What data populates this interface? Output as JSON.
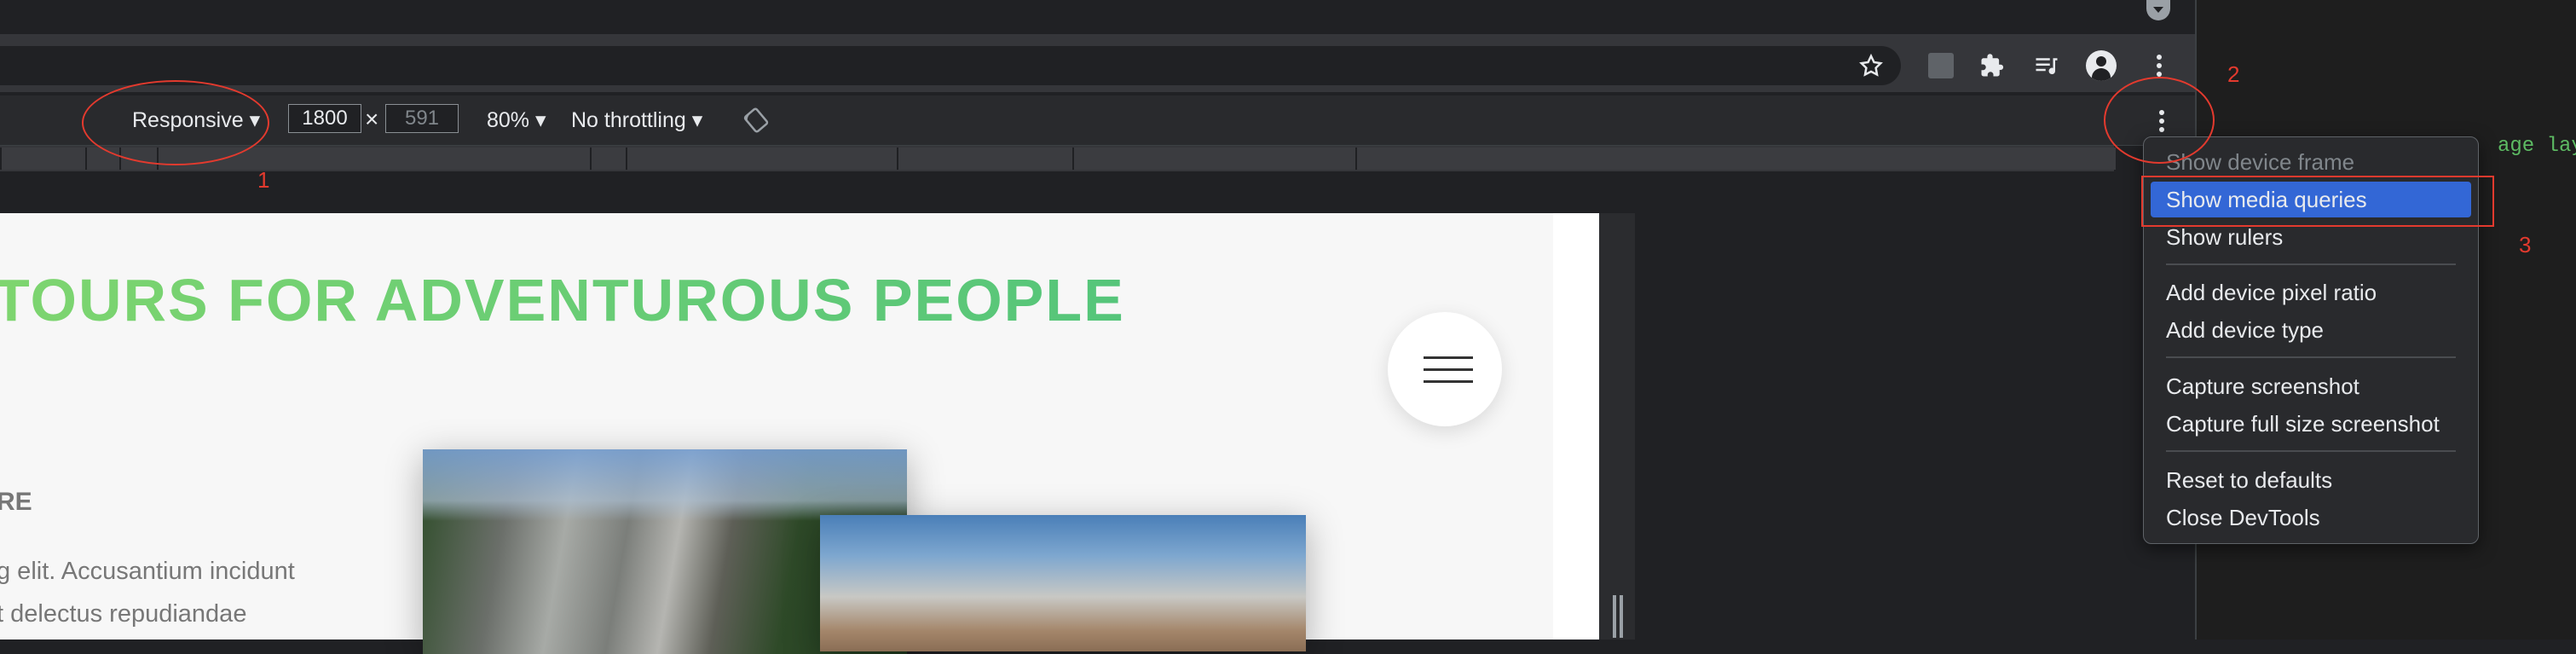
{
  "browser": {
    "tab_icon": "chevron-down-icon",
    "toolbar_icons": [
      "star-icon",
      "extension-se-icon",
      "puzzle-icon",
      "media-queue-icon",
      "profile-icon",
      "kebab-menu-icon"
    ]
  },
  "device_toolbar": {
    "device": "Responsive ▾",
    "width": "1800",
    "times": "×",
    "height": "591",
    "zoom": "80% ▾",
    "throttling": "No throttling ▾",
    "rotate_icon": "rotate-icon",
    "more_icon": "kebab-menu-icon"
  },
  "page": {
    "heading": "TOURS FOR ADVENTUROUS PEOPLE",
    "subheading": "RE",
    "para_line1": "g elit. Accusantium incidunt",
    "para_line2": "t delectus repudiandae"
  },
  "code_panel": {
    "snippet": "age layo"
  },
  "menu": {
    "items": [
      "Show device frame",
      "Show media queries",
      "Show rulers",
      "Add device pixel ratio",
      "Add device type",
      "Capture screenshot",
      "Capture full size screenshot",
      "Reset to defaults",
      "Close DevTools"
    ]
  },
  "annotations": {
    "one": "1",
    "two": "2",
    "three": "3",
    "color": "#e33a2e"
  }
}
